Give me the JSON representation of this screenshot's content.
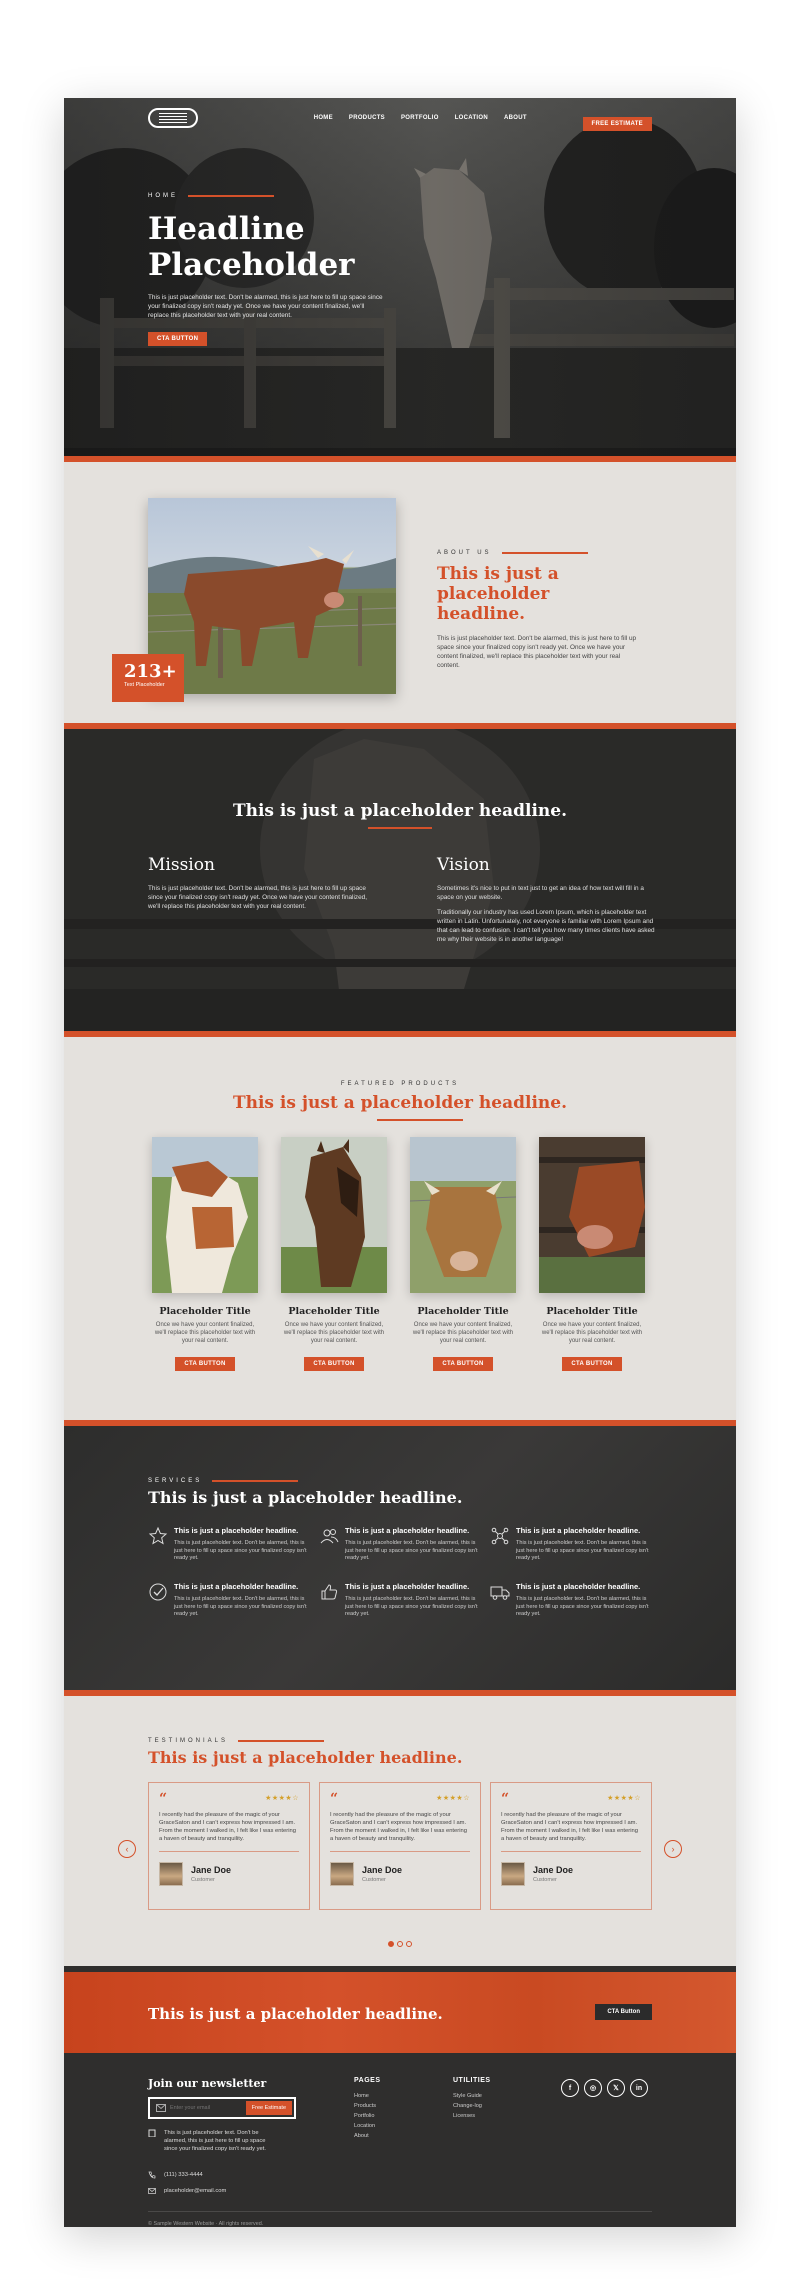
{
  "nav": {
    "links": [
      "HOME",
      "PRODUCTS",
      "PORTFOLIO",
      "LOCATION",
      "ABOUT"
    ],
    "cta": "FREE ESTIMATE"
  },
  "hero": {
    "eyebrow": "HOME",
    "headline": "Headline Placeholder",
    "body": "This is just placeholder text. Don't be alarmed, this is just here to fill up space since your finalized copy isn't ready yet. Once we have your content finalized, we'll replace this placeholder text with your real content.",
    "cta": "CTA BUTTON"
  },
  "about": {
    "eyebrow": "ABOUT US",
    "headline": "This is just a placeholder headline.",
    "body": "This is just placeholder text. Don't be alarmed, this is just here to fill up space since your finalized copy isn't ready yet. Once we have your content finalized, we'll replace this placeholder text with your real content.",
    "stat_value": "213+",
    "stat_label": "Text Placeholder"
  },
  "mission_vision": {
    "headline": "This is just a placeholder headline.",
    "mission_title": "Mission",
    "mission_body": "This is just placeholder text. Don't be alarmed, this is just here to fill up space since your finalized copy isn't ready yet. Once we have your content finalized, we'll replace this placeholder text with your real content.",
    "vision_title": "Vision",
    "vision_body_1": "Sometimes it's nice to put in text just to get an idea of how text will fill in a space on your website.",
    "vision_body_2": "Traditionally our industry has used Lorem Ipsum, which is placeholder text written in Latin. Unfortunately, not everyone is familiar with Lorem Ipsum and that can lead to confusion. I can't tell you how many times clients have asked me why their website is in another language!"
  },
  "products": {
    "eyebrow": "FEATURED PRODUCTS",
    "headline": "This is just a placeholder headline.",
    "items": [
      {
        "title": "Placeholder Title",
        "body": "Once we have your content finalized, we'll replace this placeholder text with your real content.",
        "cta": "CTA BUTTON"
      },
      {
        "title": "Placeholder Title",
        "body": "Once we have your content finalized, we'll replace this placeholder text with your real content.",
        "cta": "CTA BUTTON"
      },
      {
        "title": "Placeholder Title",
        "body": "Once we have your content finalized, we'll replace this placeholder text with your real content.",
        "cta": "CTA BUTTON"
      },
      {
        "title": "Placeholder Title",
        "body": "Once we have your content finalized, we'll replace this placeholder text with your real content.",
        "cta": "CTA BUTTON"
      }
    ]
  },
  "services": {
    "eyebrow": "SERVICES",
    "headline": "This is just a placeholder headline.",
    "items": [
      {
        "icon": "star-outline-icon",
        "title": "This is just a placeholder headline.",
        "body": "This is just placeholder text. Don't be alarmed, this is just here to fill up space since your finalized copy isn't ready yet."
      },
      {
        "icon": "users-icon",
        "title": "This is just a placeholder headline.",
        "body": "This is just placeholder text. Don't be alarmed, this is just here to fill up space since your finalized copy isn't ready yet."
      },
      {
        "icon": "network-icon",
        "title": "This is just a placeholder headline.",
        "body": "This is just placeholder text. Don't be alarmed, this is just here to fill up space since your finalized copy isn't ready yet."
      },
      {
        "icon": "check-circle-icon",
        "title": "This is just a placeholder headline.",
        "body": "This is just placeholder text. Don't be alarmed, this is just here to fill up space since your finalized copy isn't ready yet."
      },
      {
        "icon": "thumbs-up-icon",
        "title": "This is just a placeholder headline.",
        "body": "This is just placeholder text. Don't be alarmed, this is just here to fill up space since your finalized copy isn't ready yet."
      },
      {
        "icon": "truck-icon",
        "title": "This is just a placeholder headline.",
        "body": "This is just placeholder text. Don't be alarmed, this is just here to fill up space since your finalized copy isn't ready yet."
      }
    ]
  },
  "testimonials": {
    "eyebrow": "TESTIMONIALS",
    "headline": "This is just a placeholder headline.",
    "items": [
      {
        "text": "I recently had the pleasure of the magic of your GraceSaton and I can't express how impressed I am. From the moment I walked in, I felt like I was entering a haven of beauty and tranquility.",
        "name": "Jane Doe",
        "role": "Customer",
        "stars": "★★★★☆"
      },
      {
        "text": "I recently had the pleasure of the magic of your GraceSaton and I can't express how impressed I am. From the moment I walked in, I felt like I was entering a haven of beauty and tranquility.",
        "name": "Jane Doe",
        "role": "Customer",
        "stars": "★★★★☆"
      },
      {
        "text": "I recently had the pleasure of the magic of your GraceSaton and I can't express how impressed I am. From the moment I walked in, I felt like I was entering a haven of beauty and tranquility.",
        "name": "Jane Doe",
        "role": "Customer",
        "stars": "★★★★☆"
      }
    ],
    "prev": "‹",
    "next": "›"
  },
  "cta_banner": {
    "headline": "This is just a placeholder headline.",
    "button": "CTA Button"
  },
  "footer": {
    "newsletter_title": "Join our newsletter",
    "email_placeholder": "Enter your email",
    "subscribe": "Free Estimate",
    "address": "This is just placeholder text. Don't be alarmed, this is just here to fill up space since your finalized copy isn't ready yet.",
    "phone": "(111) 333-4444",
    "email": "placeholder@email.com",
    "pages_title": "PAGES",
    "pages": [
      "Home",
      "Products",
      "Portfolio",
      "Location",
      "About"
    ],
    "utilities_title": "UTILITIES",
    "utilities": [
      "Style Guide",
      "Change-log",
      "Licenses"
    ],
    "socials": [
      "f",
      "◎",
      "𝕏",
      "in"
    ],
    "copyright": "© Sample Western Website  ·  All rights reserved."
  },
  "colors": {
    "accent": "#d4512a",
    "dark": "#2f2e2d",
    "light_bg": "#e4e1dd"
  }
}
